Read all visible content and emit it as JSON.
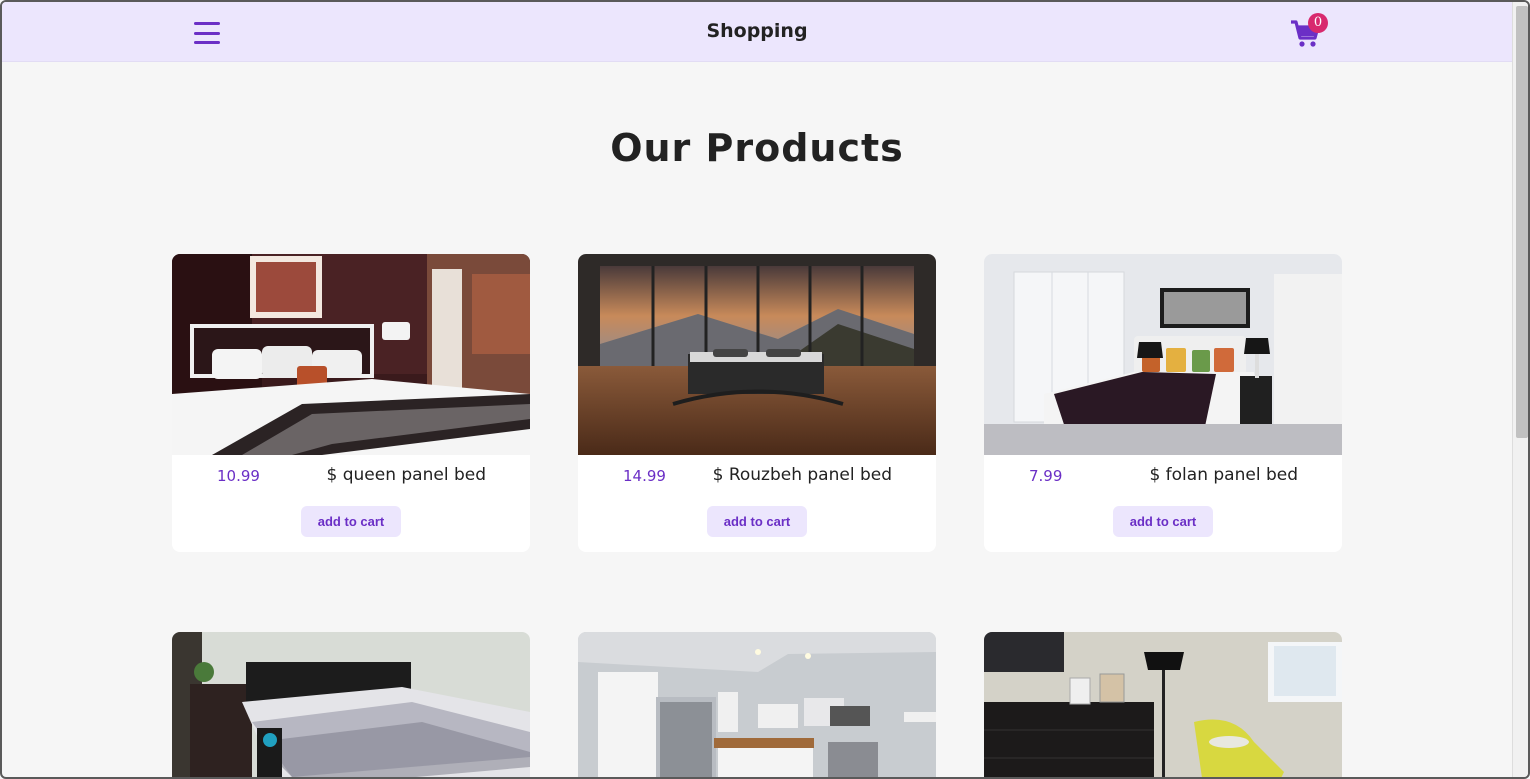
{
  "navbar": {
    "brand": "Shopping",
    "cart_count": "0",
    "menu_icon": "hamburger-icon",
    "cart_icon": "cart-icon"
  },
  "main": {
    "title": "Our Products",
    "add_label": "add to cart",
    "products": [
      {
        "price": "10.99",
        "name": "$ queen panel bed"
      },
      {
        "price": "14.99",
        "name": "$ Rouzbeh panel bed"
      },
      {
        "price": "7.99",
        "name": "$ folan panel bed"
      }
    ]
  },
  "colors": {
    "accent": "#6b2fc6",
    "nav_bg": "#ece6fd",
    "badge": "#d8296e"
  }
}
